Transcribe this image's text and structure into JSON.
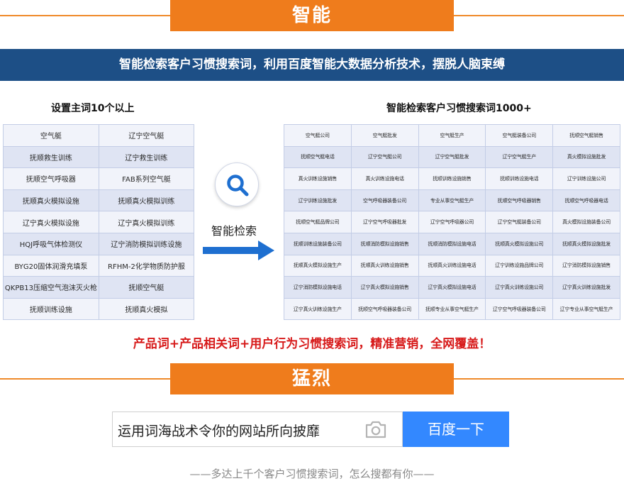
{
  "section1": {
    "title": "智能"
  },
  "banner": {
    "text": "智能检索客户习惯搜索词，利用百度智能大数据分析技术，摆脱人脑束缚"
  },
  "left": {
    "title": "设置主词10个以上",
    "rows": [
      [
        "空气艇",
        "辽宁空气艇"
      ],
      [
        "抚顺救生训练",
        "辽宁救生训练"
      ],
      [
        "抚顺空气呼吸器",
        "FAB系列空气艇"
      ],
      [
        "抚顺真火模拟设施",
        "抚顺真火模拟训练"
      ],
      [
        "辽宁真火模拟设施",
        "辽宁真火模拟训练"
      ],
      [
        "HQJ呼吸气体检测仪",
        "辽宁消防模拟训练设施"
      ],
      [
        "BYG20固体润滑充填泵",
        "RFHM-2化学物质防护服"
      ],
      [
        "QKPB13压缩空气泡沫灭火枪",
        "抚顺空气艇"
      ],
      [
        "抚顺训练设施",
        "抚顺真火模拟"
      ]
    ]
  },
  "middle": {
    "label": "智能检索"
  },
  "right": {
    "title": "智能检索客户习惯搜索词1000+",
    "rows": [
      [
        "空气艇公司",
        "空气艇批发",
        "空气艇生产",
        "空气艇装备公司",
        "抚顺空气艇销售"
      ],
      [
        "抚顺空气艇电话",
        "辽宁空气艇公司",
        "辽宁空气艇批发",
        "辽宁空气艇生产",
        "真火模拟设施批发"
      ],
      [
        "真火训练设施销售",
        "真火训练设施电话",
        "抚顺训练设施销售",
        "抚顺训练设施电话",
        "辽宁训练设施公司"
      ],
      [
        "辽宁训练设施批发",
        "空气呼吸器装备公司",
        "专业从事空气艇生产",
        "抚顺空气呼吸器销售",
        "抚顺空气呼吸器电话"
      ],
      [
        "抚顺空气艇品牌公司",
        "辽宁空气呼吸器批发",
        "辽宁空气呼吸器公司",
        "辽宁空气艇装备公司",
        "真火模拟设施装备公司"
      ],
      [
        "抚顺训练设施装备公司",
        "抚顺消防模拟设施销售",
        "抚顺消防模拟设施电话",
        "抚顺真火模拟设施公司",
        "抚顺真火模拟设施批发"
      ],
      [
        "抚顺真火模拟设施生产",
        "抚顺真火训练设施销售",
        "抚顺真火训练设施电话",
        "辽宁训练设施品牌公司",
        "辽宁消防模拟设施销售"
      ],
      [
        "辽宁消防模拟设施电话",
        "辽宁真火模拟设施销售",
        "辽宁真火模拟设施电话",
        "辽宁真火训练设施公司",
        "辽宁真火训练设施批发"
      ],
      [
        "辽宁真火训练设施生产",
        "抚顺空气呼吸器装备公司",
        "抚顺专业从事空气艇生产",
        "辽宁空气呼吸器装备公司",
        "辽宁专业从事空气艇生产"
      ]
    ]
  },
  "slogan": "产品词+产品相关词+用户行为习惯搜索词，精准营销，全网覆盖！",
  "section2": {
    "title": "猛烈"
  },
  "search": {
    "query": "运用词海战术令你的网站所向披靡",
    "button_label": "百度一下",
    "camera_icon": "camera-icon"
  },
  "footer": "——多达上千个客户习惯搜索词，怎么搜都有你——",
  "colors": {
    "orange": "#ef7c1c",
    "banner_blue": "#1d4f86",
    "search_blue": "#3388ff",
    "slogan_red": "#d71a1a"
  }
}
